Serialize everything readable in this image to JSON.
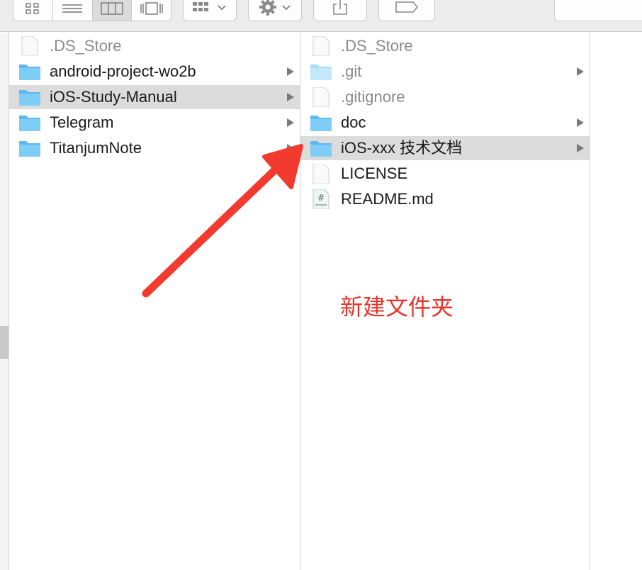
{
  "toolbar": {
    "view_buttons": [
      "icon-view-icon",
      "list-view-icon",
      "column-view-icon",
      "cover-flow-icon"
    ],
    "active_view": "column-view-icon"
  },
  "columns": {
    "first": {
      "items": [
        {
          "label": ".DS_Store",
          "kind": "file",
          "dim": true
        },
        {
          "label": "android-project-wo2b",
          "kind": "folder",
          "dim": false
        },
        {
          "label": "iOS-Study-Manual",
          "kind": "folder",
          "dim": false,
          "selected": true
        },
        {
          "label": "Telegram",
          "kind": "folder",
          "dim": false
        },
        {
          "label": "TitanjumNote",
          "kind": "folder",
          "dim": false
        }
      ]
    },
    "second": {
      "items": [
        {
          "label": ".DS_Store",
          "kind": "file",
          "dim": true
        },
        {
          "label": ".git",
          "kind": "folder",
          "dim": true
        },
        {
          "label": ".gitignore",
          "kind": "file",
          "dim": true
        },
        {
          "label": "doc",
          "kind": "folder",
          "dim": false
        },
        {
          "label": "iOS-xxx 技术文档",
          "kind": "folder",
          "dim": false,
          "selected": true
        },
        {
          "label": "LICENSE",
          "kind": "file",
          "dim": false
        },
        {
          "label": "README.md",
          "kind": "markdown",
          "dim": false
        }
      ]
    }
  },
  "annotation": {
    "text": "新建文件夹",
    "color": "#e8332a"
  },
  "colors": {
    "folder": "#6ec6f5",
    "selection": "#dcdcdc",
    "arrow": "#f23b2e"
  }
}
